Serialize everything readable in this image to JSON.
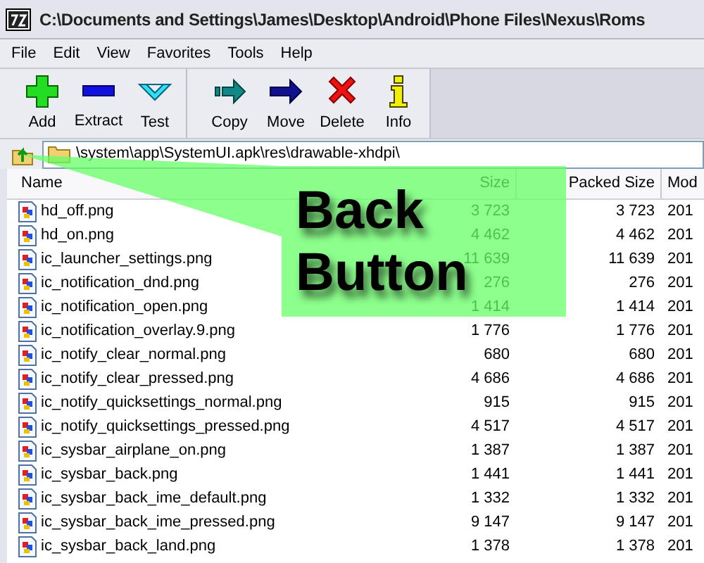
{
  "window": {
    "title": "C:\\Documents and Settings\\James\\Desktop\\Android\\Phone Files\\Nexus\\Roms"
  },
  "menu": [
    "File",
    "Edit",
    "View",
    "Favorites",
    "Tools",
    "Help"
  ],
  "toolbar": [
    [
      {
        "kind": "add",
        "label": "Add"
      },
      {
        "kind": "extract",
        "label": "Extract"
      },
      {
        "kind": "test",
        "label": "Test"
      }
    ],
    [
      {
        "kind": "copy",
        "label": "Copy"
      },
      {
        "kind": "move",
        "label": "Move"
      },
      {
        "kind": "delete",
        "label": "Delete"
      },
      {
        "kind": "info",
        "label": "Info"
      }
    ]
  ],
  "address": {
    "path": "\\system\\app\\SystemUI.apk\\res\\drawable-xhdpi\\"
  },
  "table": {
    "columns": [
      "Name",
      "Size",
      "Packed Size",
      "Mod"
    ],
    "rows": [
      [
        "hd_off.png",
        "3 723",
        "3 723",
        "201"
      ],
      [
        "hd_on.png",
        "4 462",
        "4 462",
        "201"
      ],
      [
        "ic_launcher_settings.png",
        "11 639",
        "11 639",
        "201"
      ],
      [
        "ic_notification_dnd.png",
        "276",
        "276",
        "201"
      ],
      [
        "ic_notification_open.png",
        "1 414",
        "1 414",
        "201"
      ],
      [
        "ic_notification_overlay.9.png",
        "1 776",
        "1 776",
        "201"
      ],
      [
        "ic_notify_clear_normal.png",
        "680",
        "680",
        "201"
      ],
      [
        "ic_notify_clear_pressed.png",
        "4 686",
        "4 686",
        "201"
      ],
      [
        "ic_notify_quicksettings_normal.png",
        "915",
        "915",
        "201"
      ],
      [
        "ic_notify_quicksettings_pressed.png",
        "4 517",
        "4 517",
        "201"
      ],
      [
        "ic_sysbar_airplane_on.png",
        "1 387",
        "1 387",
        "201"
      ],
      [
        "ic_sysbar_back.png",
        "1 441",
        "1 441",
        "201"
      ],
      [
        "ic_sysbar_back_ime_default.png",
        "1 332",
        "1 332",
        "201"
      ],
      [
        "ic_sysbar_back_ime_pressed.png",
        "9 147",
        "9 147",
        "201"
      ],
      [
        "ic_sysbar_back_land.png",
        "1 378",
        "1 378",
        "201"
      ]
    ]
  },
  "callout": {
    "text": "Back Button"
  }
}
